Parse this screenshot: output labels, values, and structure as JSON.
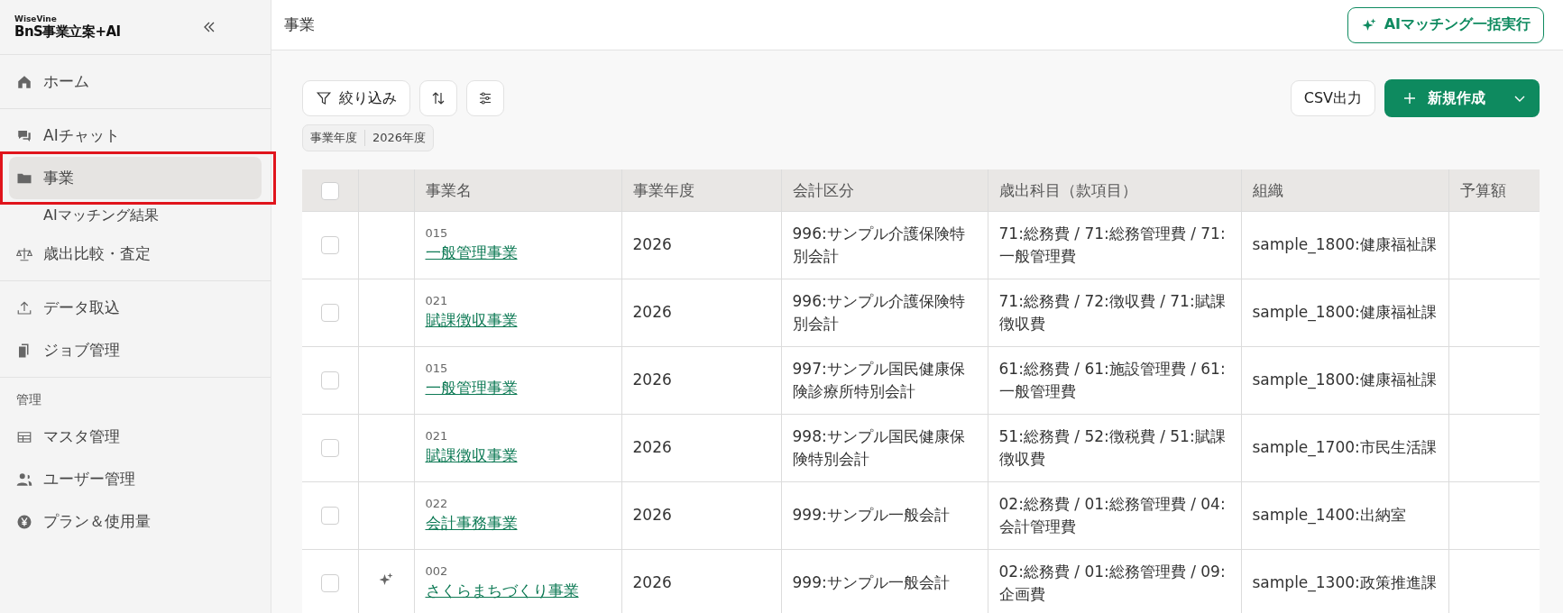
{
  "sidebar": {
    "brand_small": "WiseVine",
    "brand": "BnS事業立案+AI",
    "groups": [
      {
        "items": [
          {
            "label": "ホーム",
            "selected": false
          }
        ]
      },
      {
        "items": [
          {
            "label": "AIチャット",
            "selected": false
          },
          {
            "label": "事業",
            "selected": true,
            "highlighted": true,
            "children": [
              {
                "label": "AIマッチング結果",
                "selected": false
              }
            ]
          },
          {
            "label": "歳出比較・査定",
            "selected": false
          }
        ]
      },
      {
        "items": [
          {
            "label": "データ取込",
            "selected": false
          },
          {
            "label": "ジョブ管理",
            "selected": false
          }
        ]
      },
      {
        "heading": "管理",
        "items": [
          {
            "label": "マスタ管理",
            "selected": false
          },
          {
            "label": "ユーザー管理",
            "selected": false
          },
          {
            "label": "プラン＆使用量",
            "selected": false
          }
        ]
      }
    ]
  },
  "header": {
    "title": "事業",
    "action": "AIマッチング一括実行"
  },
  "toolbar": {
    "filter": "絞り込み",
    "csv": "CSV出力",
    "create": "新規作成"
  },
  "filter_chip": {
    "key": "事業年度",
    "value": "2026年度"
  },
  "table": {
    "select_all_checked": false,
    "columns": [
      "事業名",
      "事業年度",
      "会計区分",
      "歳出科目（款項目）",
      "組織",
      "予算額"
    ],
    "rows": [
      {
        "checked": false,
        "ai_matched": false,
        "code": "015",
        "name": "一般管理事業",
        "year": "2026",
        "account": "996:サンプル介護保険特別会計",
        "expenditure": "71:総務費 / 71:総務管理費 / 71:一般管理費",
        "org": "sample_1800:健康福祉課"
      },
      {
        "checked": false,
        "ai_matched": false,
        "code": "021",
        "name": "賦課徴収事業",
        "year": "2026",
        "account": "996:サンプル介護保険特別会計",
        "expenditure": "71:総務費 / 72:徴収費 / 71:賦課徴収費",
        "org": "sample_1800:健康福祉課"
      },
      {
        "checked": false,
        "ai_matched": false,
        "code": "015",
        "name": "一般管理事業",
        "year": "2026",
        "account": "997:サンプル国民健康保険診療所特別会計",
        "expenditure": "61:総務費 / 61:施設管理費 / 61:一般管理費",
        "org": "sample_1800:健康福祉課"
      },
      {
        "checked": false,
        "ai_matched": false,
        "code": "021",
        "name": "賦課徴収事業",
        "year": "2026",
        "account": "998:サンプル国民健康保険特別会計",
        "expenditure": "51:総務費 / 52:徴税費 / 51:賦課徴収費",
        "org": "sample_1700:市民生活課"
      },
      {
        "checked": false,
        "ai_matched": false,
        "code": "022",
        "name": "会計事務事業",
        "year": "2026",
        "account": "999:サンプル一般会計",
        "expenditure": "02:総務費 / 01:総務管理費 / 04:会計管理費",
        "org": "sample_1400:出納室"
      },
      {
        "checked": false,
        "ai_matched": true,
        "code": "002",
        "name": "さくらまちづくり事業",
        "year": "2026",
        "account": "999:サンプル一般会計",
        "expenditure": "02:総務費 / 01:総務管理費 / 09:企画費",
        "org": "sample_1300:政策推進課"
      }
    ]
  }
}
